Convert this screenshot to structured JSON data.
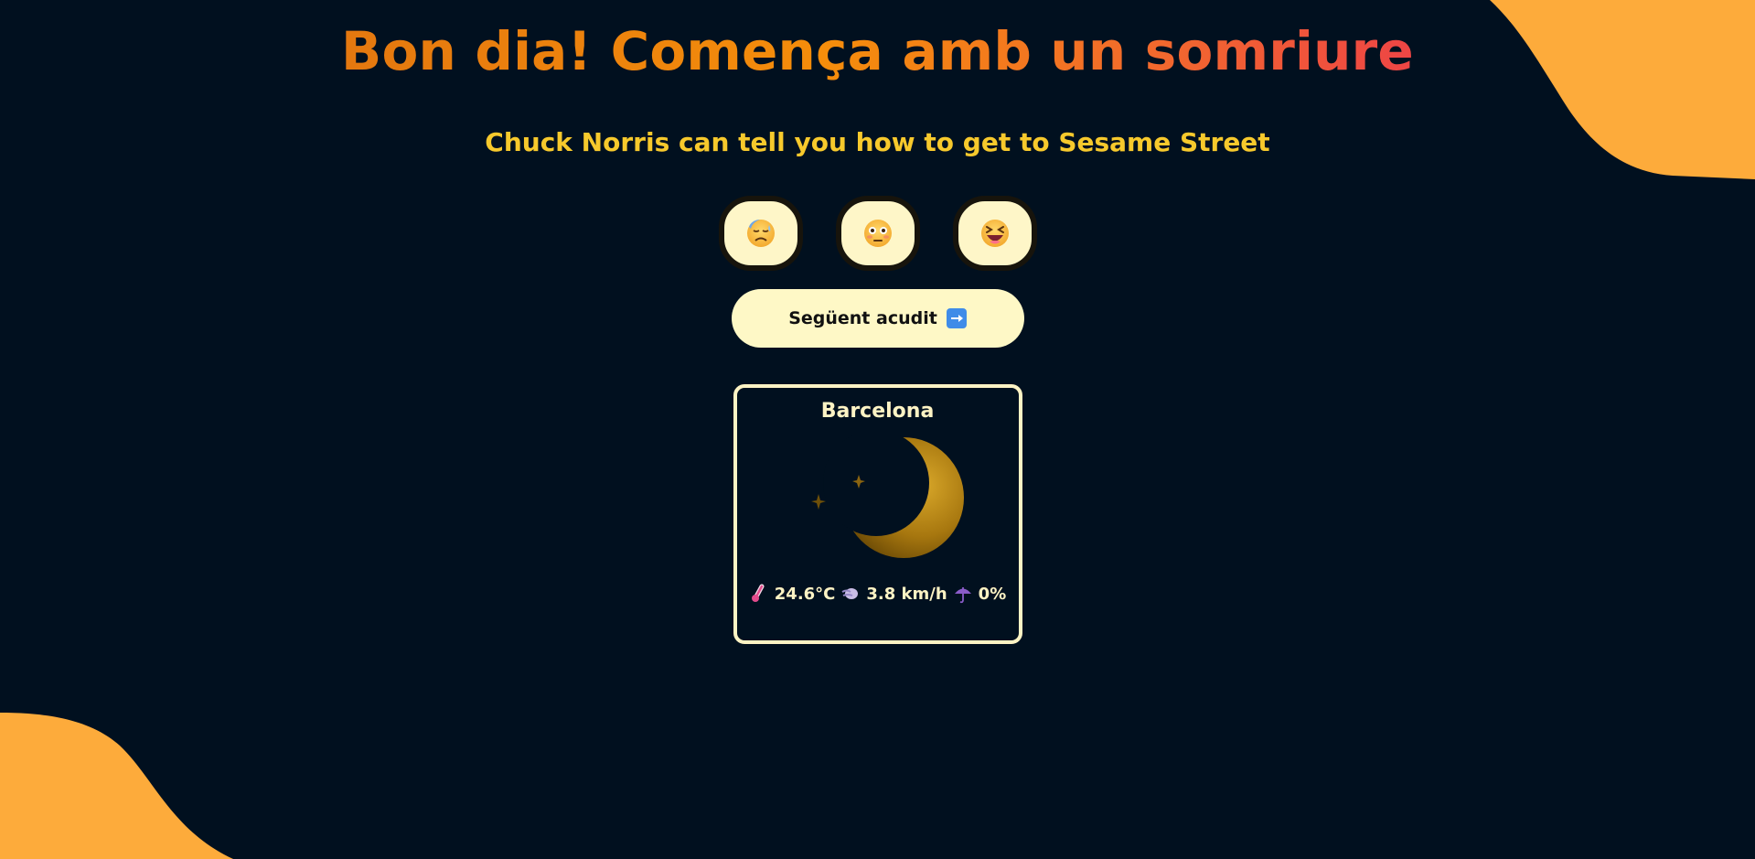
{
  "header": {
    "title": "Bon dia! Comença amb un somriure"
  },
  "joke": {
    "text": "Chuck Norris can tell you how to get to Sesame Street"
  },
  "reactions": [
    {
      "icon": "downcast-sweat-face-icon"
    },
    {
      "icon": "flushed-face-icon"
    },
    {
      "icon": "squinting-laughing-face-icon"
    }
  ],
  "next_button": {
    "label": "Següent acudit",
    "icon": "right-arrow-icon"
  },
  "weather": {
    "city": "Barcelona",
    "icon": "crescent-moon-stars-icon",
    "temperature": "24.6°C",
    "wind": "3.8 km/h",
    "precipitation": "0%"
  },
  "colors": {
    "background": "#01101f",
    "accent_blob": "#fdab3b",
    "title_gradient_start": "#e4780f",
    "title_gradient_end": "#ee4545",
    "joke_text": "#f7c92c",
    "button_bg": "#fef8c6",
    "card_border": "#fdf3c4"
  }
}
